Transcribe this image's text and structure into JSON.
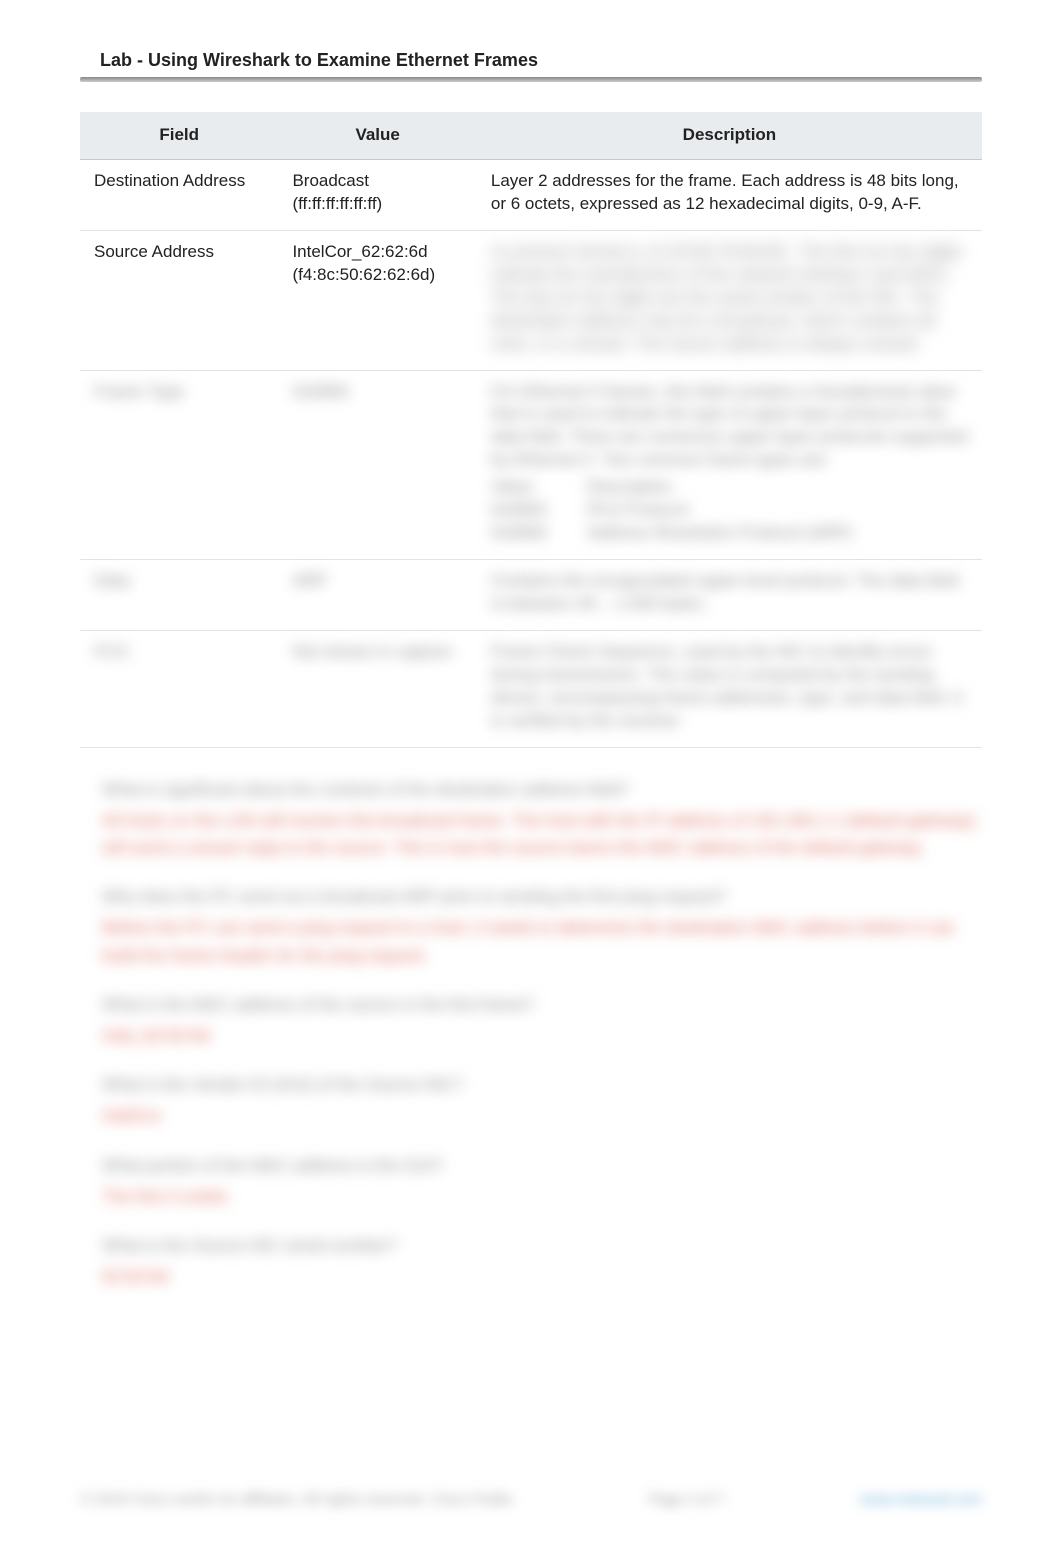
{
  "title": "Lab - Using Wireshark to Examine Ethernet Frames",
  "table": {
    "headers": {
      "field": "Field",
      "value": "Value",
      "description": "Description"
    },
    "rows": [
      {
        "field": "Destination Address",
        "value": "Broadcast (ff:ff:ff:ff:ff:ff)",
        "desc": "Layer 2 addresses for the frame. Each address is 48 bits long, or 6 octets, expressed as 12 hexadecimal digits, 0-9, A-F."
      },
      {
        "field": "Source Address",
        "value": "IntelCor_62:62:6d (f4:8c:50:62:62:6d)",
        "desc_blur": "A common format is 12:34:56:78:9A:BC. The first six hex digits indicate the manufacturer of the network interface card (NIC). The last six hex digits are the serial number of the NIC. The destination address may be a broadcast, which contains all ones, or a unicast. The source address is always unicast."
      },
      {
        "field_blur": "Frame Type",
        "value_blur": "0x0806",
        "desc_blur": "For Ethernet II frames, this field contains a hexadecimal value that is used to indicate the type of upper-layer protocol in the data field. There are numerous upper-layer protocols supported by Ethernet II. Two common frame types are:",
        "sub": [
          {
            "k": "Value",
            "v": "Description"
          },
          {
            "k": "0x0800",
            "v": "IPv4 Protocol"
          },
          {
            "k": "0x0806",
            "v": "Address Resolution Protocol (ARP)"
          }
        ]
      },
      {
        "field_blur": "Data",
        "value_blur": "ARP",
        "desc_blur": "Contains the encapsulated upper-level protocol. The data field is between 46 – 1,500 bytes."
      },
      {
        "field_blur": "FCS",
        "value_blur": "Not shown in capture",
        "desc_blur": "Frame Check Sequence, used by the NIC to identify errors during transmission. The value is computed by the sending device, encompassing frame addresses, type, and data field. It is verified by the receiver."
      }
    ]
  },
  "qa": [
    {
      "q": "What is significant about the contents of the destination address field?",
      "a": "All hosts on the LAN will receive this broadcast frame. The host with the IP address of 192.168.1.1 (default gateway) will send a unicast reply to the source. This is how the source learns the MAC address of the default gateway."
    },
    {
      "q": "Why does the PC send out a broadcast ARP prior to sending the first ping request?",
      "a": "Before the PC can send a ping request to a host, it needs to determine the destination MAC address before it can build the frame header for the ping request."
    },
    {
      "q": "What is the MAC address of the source in the first frame?",
      "a": "Intel_62:62:6d"
    },
    {
      "q": "What is the Vendor ID (OUI) of the Source NIC?",
      "a": "IntelCor"
    },
    {
      "q": "What portion of the MAC address is the OUI?",
      "a": "The first 3 octets"
    },
    {
      "q": "What is the Source NIC serial number?",
      "a": "62:62:6d"
    }
  ],
  "footer": {
    "left": "© 2019 Cisco and/or its affiliates. All rights reserved. Cisco Public",
    "mid": "Page 3 of 7",
    "right": "www.netacad.com"
  }
}
